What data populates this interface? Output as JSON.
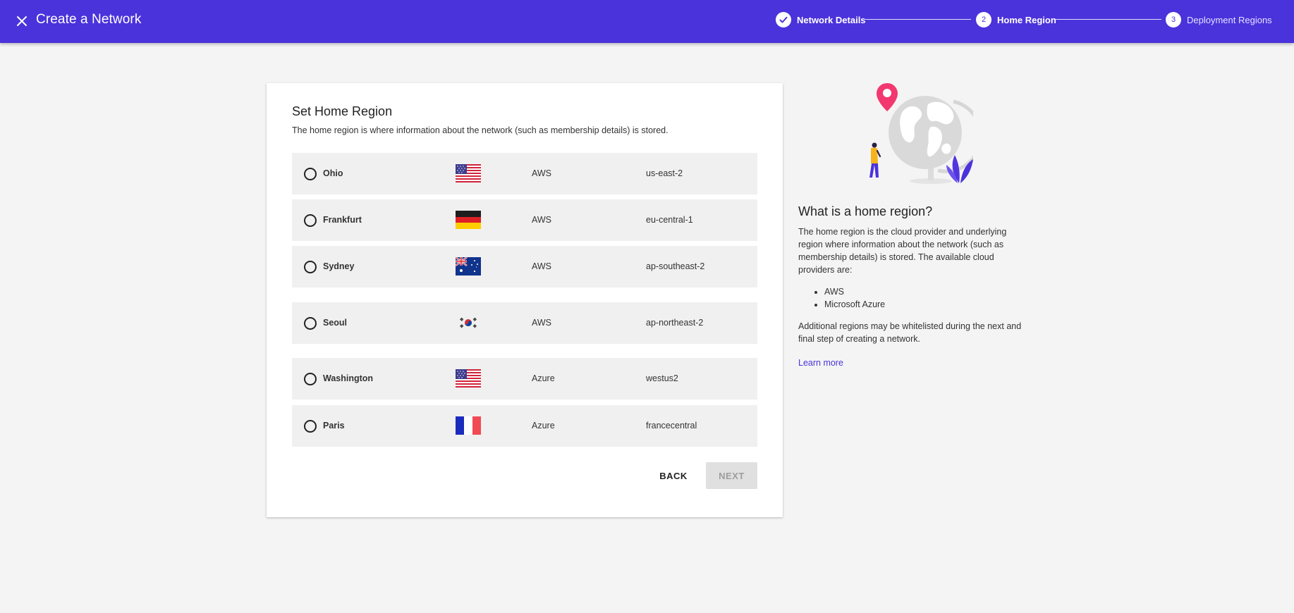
{
  "header": {
    "title": "Create a Network",
    "close_icon": "close-icon"
  },
  "stepper": [
    {
      "number": "",
      "label": "Network Details",
      "state": "completed"
    },
    {
      "number": "2",
      "label": "Home Region",
      "state": "active"
    },
    {
      "number": "3",
      "label": "Deployment Regions",
      "state": "upcoming"
    }
  ],
  "card": {
    "title": "Set Home Region",
    "description": "The home region is where information about the network (such as membership details) is stored."
  },
  "regions": [
    {
      "city": "Ohio",
      "flag": "us-flag",
      "provider": "AWS",
      "code": "us-east-2",
      "selected": false
    },
    {
      "city": "Frankfurt",
      "flag": "de-flag",
      "provider": "AWS",
      "code": "eu-central-1",
      "selected": false
    },
    {
      "city": "Sydney",
      "flag": "au-flag",
      "provider": "AWS",
      "code": "ap-southeast-2",
      "selected": false
    },
    {
      "city": "Seoul",
      "flag": "kr-flag",
      "provider": "AWS",
      "code": "ap-northeast-2",
      "selected": false
    },
    {
      "city": "Washington",
      "flag": "us-flag",
      "provider": "Azure",
      "code": "westus2",
      "selected": false
    },
    {
      "city": "Paris",
      "flag": "fr-flag",
      "provider": "Azure",
      "code": "francecentral",
      "selected": false
    }
  ],
  "buttons": {
    "back": "BACK",
    "next": "NEXT",
    "next_disabled": true
  },
  "info": {
    "title": "What is a home region?",
    "paragraph1": "The home region is the cloud provider and underlying region where information about the network (such as membership details) is stored. The available cloud providers are:",
    "providers": [
      "AWS",
      "Microsoft Azure"
    ],
    "paragraph2": "Additional regions may be whitelisted during the next and final step of creating a network.",
    "link": "Learn more"
  },
  "colors": {
    "brand": "#4a33db",
    "pin": "#f2386e",
    "row_background": "#f0f0f0"
  }
}
